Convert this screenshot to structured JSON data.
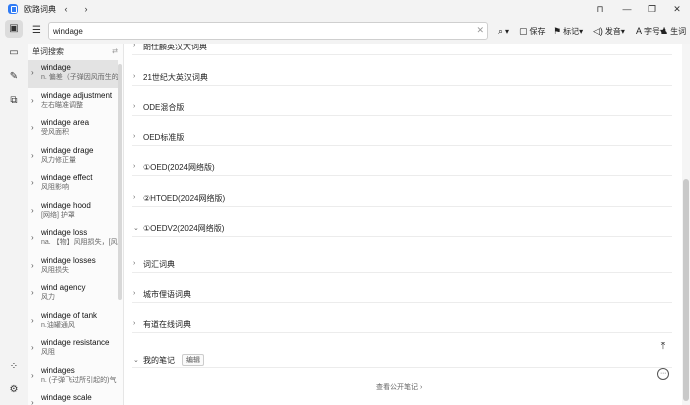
{
  "window": {
    "title": "欧路词典",
    "back_glyph": "‹",
    "forward_glyph": "›",
    "pin_glyph": "⊓",
    "minimize_glyph": "—",
    "maximize_glyph": "❐",
    "close_glyph": "✕"
  },
  "rail": {
    "items": [
      {
        "icon": "dictionary-icon",
        "glyph": "▣",
        "active": true
      },
      {
        "icon": "book-icon",
        "glyph": "▭",
        "active": false
      },
      {
        "icon": "pen-icon",
        "glyph": "✎",
        "active": false
      },
      {
        "icon": "translate-icon",
        "glyph": "⧉",
        "active": false
      }
    ],
    "bottom": [
      {
        "icon": "apps-icon",
        "glyph": "⁘"
      },
      {
        "icon": "settings-icon",
        "glyph": "⚙"
      }
    ]
  },
  "search": {
    "value": "windage",
    "clear_glyph": "✕",
    "list_glyph": "☰"
  },
  "toolbar": {
    "search_glyph": "⌕",
    "search_dropdown_glyph": "▾",
    "save_glyph": "▢",
    "save_label": "保存",
    "mark_glyph": "⚑",
    "mark_label": "标记",
    "mark_dropdown_glyph": "▾",
    "pronounce_glyph": "◁)",
    "pronounce_label": "发音",
    "pronounce_dropdown_glyph": "▾",
    "font_glyph": "A",
    "font_label": "字号",
    "font_dropdown_glyph": "▾",
    "vocab_glyph": "♟",
    "vocab_label": "生词"
  },
  "sidebar": {
    "header": "单词搜索",
    "pin_glyph": "⇄",
    "items": [
      {
        "word": "windage",
        "def": "n. 偏差（子弹因风而生的",
        "active": true
      },
      {
        "word": "windage adjustment",
        "def": "左右瞄准调整",
        "active": false
      },
      {
        "word": "windage area",
        "def": "受风面积",
        "active": false
      },
      {
        "word": "windage drage",
        "def": "风力修正量",
        "active": false
      },
      {
        "word": "windage effect",
        "def": "风阻影响",
        "active": false
      },
      {
        "word": "windage hood",
        "def": "[网络] 护罩",
        "active": false
      },
      {
        "word": "windage loss",
        "def": "na. 【物】风阻损失，[风",
        "active": false
      },
      {
        "word": "windage losses",
        "def": "风阻损失",
        "active": false
      },
      {
        "word": "wind agency",
        "def": "风力",
        "active": false
      },
      {
        "word": "windage of tank",
        "def": "n.油罐通风",
        "active": false
      },
      {
        "word": "windage resistance",
        "def": "风阻",
        "active": false
      },
      {
        "word": "windages",
        "def": "n. (子弹飞过所引起的)气",
        "active": false
      },
      {
        "word": "windage scale",
        "def": "",
        "active": false
      }
    ]
  },
  "content": {
    "dictionaries": [
      {
        "name": "朗仕麟英汉大词典",
        "caret": "›"
      },
      {
        "name": "21世纪大英汉词典",
        "caret": "›"
      },
      {
        "name": "ODE混合版",
        "caret": "›"
      },
      {
        "name": "OED标准版",
        "caret": "›"
      },
      {
        "name": "①OED(2024网络版)",
        "caret": "›"
      },
      {
        "name": "②HTOED(2024网络版)",
        "caret": "›"
      },
      {
        "name": "①OEDV2(2024网络版)",
        "caret": "⌄"
      },
      {
        "name": "词汇词典",
        "caret": "›"
      },
      {
        "name": "城市俚语词典",
        "caret": "›"
      },
      {
        "name": "有道在线词典",
        "caret": "›"
      }
    ],
    "notes": {
      "label": "我的笔记",
      "edit_label": "编辑",
      "caret": "⌄"
    },
    "public_notes": "查看公开笔记",
    "public_notes_glyph": "›",
    "back_to_top_glyph": "⤒",
    "more_glyph": "⋯"
  }
}
